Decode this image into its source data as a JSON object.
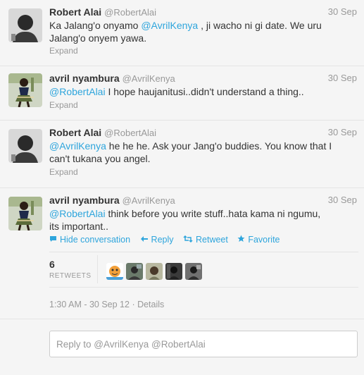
{
  "tweets": [
    {
      "fullname": "Robert Alai",
      "username": "@RobertAlai",
      "time": "30 Sep",
      "text_parts": [
        "Ka Jalang'o onyamo ",
        "@AvrilKenya",
        " , ji wacho ni gi date. We uru Jalang'o onyem yawa."
      ],
      "expand": "Expand"
    },
    {
      "fullname": "avril nyambura",
      "username": "@AvrilKenya",
      "time": "30 Sep",
      "text_parts": [
        "@RobertAlai",
        " I hope haujanitusi..didn't understand a thing.."
      ],
      "expand": "Expand"
    },
    {
      "fullname": "Robert Alai",
      "username": "@RobertAlai",
      "time": "30 Sep",
      "text_parts": [
        "@AvrilKenya",
        " he he he. Ask your Jang'o buddies. You know that I can't tukana you angel."
      ],
      "expand": "Expand"
    },
    {
      "fullname": "avril nyambura",
      "username": "@AvrilKenya",
      "time": "30 Sep",
      "text_parts": [
        "@RobertAlai",
        " think before you write stuff..hata kama ni ngumu, its important.."
      ]
    }
  ],
  "actions": {
    "hide": "Hide conversation",
    "reply": "Reply",
    "retweet": "Retweet",
    "favorite": "Favorite"
  },
  "stats": {
    "retweet_count": "6",
    "retweet_label": "RETWEETS"
  },
  "meta": "1:30 AM - 30 Sep 12 · Details",
  "reply_box": {
    "placeholder": "Reply to @AvrilKenya @RobertAlai"
  },
  "icons": {
    "hide": "speech-bubble-icon",
    "reply": "reply-arrow-icon",
    "retweet": "retweet-icon",
    "favorite": "star-icon"
  },
  "colors": {
    "link": "#2ea5dc",
    "muted": "#999999",
    "text": "#333333",
    "background": "#f5f5f5"
  }
}
